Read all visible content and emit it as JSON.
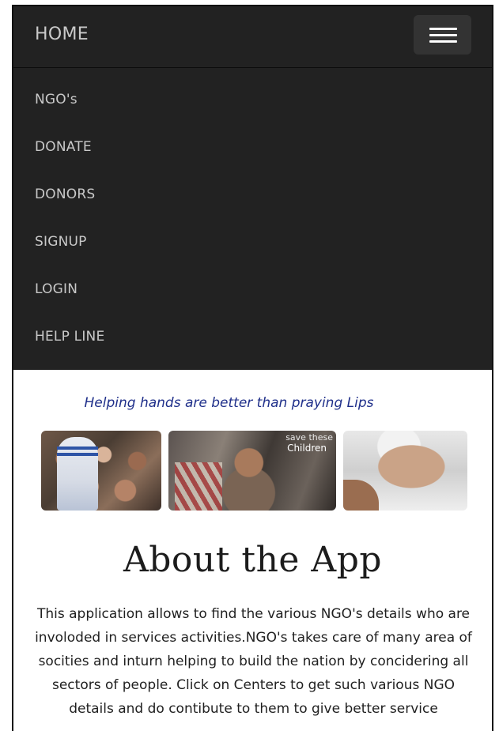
{
  "navbar": {
    "brand": "HOME",
    "toggle_icon": "hamburger-menu-icon"
  },
  "menu": {
    "items": [
      {
        "label": "NGO's"
      },
      {
        "label": "DONATE"
      },
      {
        "label": "DONORS"
      },
      {
        "label": "SIGNUP"
      },
      {
        "label": "LOGIN"
      },
      {
        "label": "HELP LINE"
      }
    ]
  },
  "banner": {
    "tagline": "Helping hands are better than praying Lips",
    "photo2_caption_line1": "save these",
    "photo2_caption_line2": "Children"
  },
  "about": {
    "heading": "About the App",
    "body": "This application allows to find the various NGO's details who are involoded in services activities.NGO's takes care of many area of socities and inturn helping to build the nation by concidering all sectors of people. Click on Centers to get such various NGO details and do contibute to them to give better service"
  },
  "colors": {
    "navbar_bg": "#222222",
    "nav_text": "#c9c9c9",
    "tagline": "#1f2f8a"
  }
}
